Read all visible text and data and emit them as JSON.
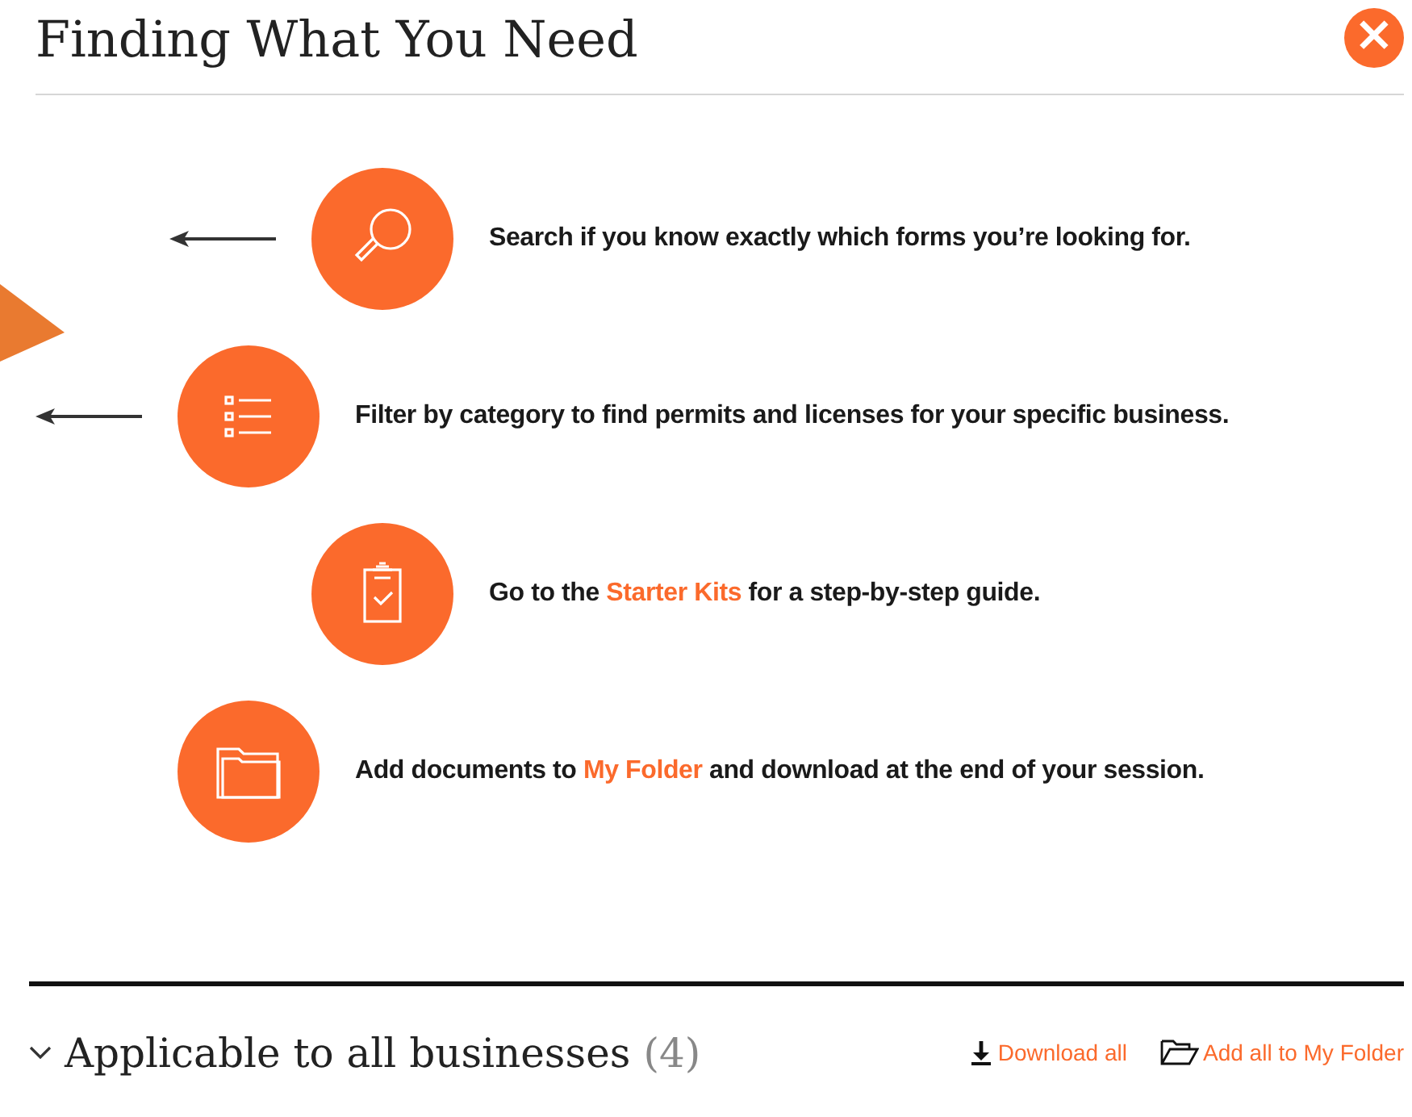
{
  "dialog": {
    "title": "Finding What You Need",
    "close": "×"
  },
  "tips": [
    {
      "kind": "search",
      "arrow": true,
      "before": "Search if you know exactly which forms you’re looking for."
    },
    {
      "kind": "filter",
      "arrow": true,
      "before": "Filter by category to find permits and licenses for your specific business."
    },
    {
      "kind": "kits",
      "arrow": false,
      "before": "Go to the ",
      "link": "Starter Kits",
      "after": " for a step-by-step guide."
    },
    {
      "kind": "folder",
      "arrow": false,
      "before": "Add documents to ",
      "link": "My Folder",
      "after": " and download at the end of your session."
    }
  ],
  "section": {
    "title": "Applicable to all businesses",
    "count": "(4)",
    "expanded": true,
    "actions": [
      {
        "kind": "download",
        "label": "Download all"
      },
      {
        "kind": "folder",
        "label": "Add all to My Folder"
      }
    ]
  }
}
